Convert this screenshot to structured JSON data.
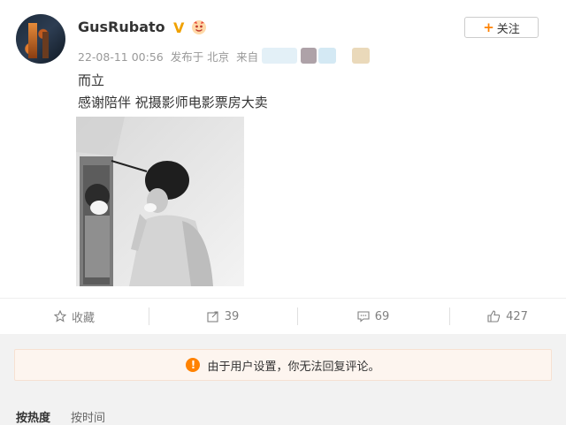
{
  "post": {
    "username": "GusRubato",
    "verified_badge": "V",
    "timestamp": "22-08-11 00:56",
    "location": "发布于 北京",
    "source_label": "来自",
    "follow_plus": "+",
    "follow_label": "关注",
    "text_line1": "而立",
    "text_line2": "感谢陪伴 祝摄影师电影票房大卖",
    "image_description_icon": "photo"
  },
  "actions": {
    "favorite_label": "收藏",
    "repost_count": "39",
    "comment_count": "69",
    "like_count": "427"
  },
  "notice": {
    "icon": "warning-icon",
    "text": "由于用户设置，你无法回复评论。"
  },
  "sort_tabs": {
    "by_hot": "按热度",
    "by_time": "按时间"
  },
  "colors": {
    "accent": "#ff8200",
    "notice_bg": "#fdf5ef",
    "muted_text": "#808080"
  }
}
